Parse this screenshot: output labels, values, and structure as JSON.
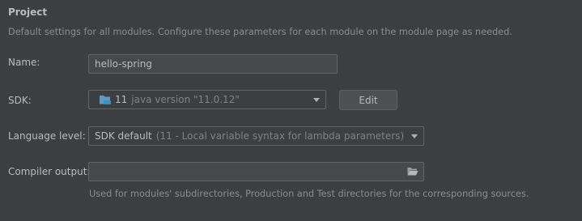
{
  "section": {
    "title": "Project",
    "subtitle": "Default settings for all modules. Configure these parameters for each module on the module page as needed."
  },
  "name": {
    "label": "Name:",
    "value": "hello-spring"
  },
  "sdk": {
    "label": "SDK:",
    "version": "11",
    "detail": "java version \"11.0.12\"",
    "edit_label": "Edit"
  },
  "language_level": {
    "label": "Language level:",
    "value": "SDK default",
    "detail": "(11 - Local variable syntax for lambda parameters)"
  },
  "compiler_output": {
    "label": "Compiler output:",
    "value": "",
    "hint": "Used for modules' subdirectories, Production and Test directories for the corresponding sources."
  },
  "icons": {
    "sdk": "folder-sdk-icon",
    "browse": "folder-open-icon"
  },
  "colors": {
    "background": "#3c3f41",
    "text": "#bbbbbb",
    "muted": "#8c8c8c",
    "field_border": "#646464",
    "folder_icon": "#6897bb"
  }
}
